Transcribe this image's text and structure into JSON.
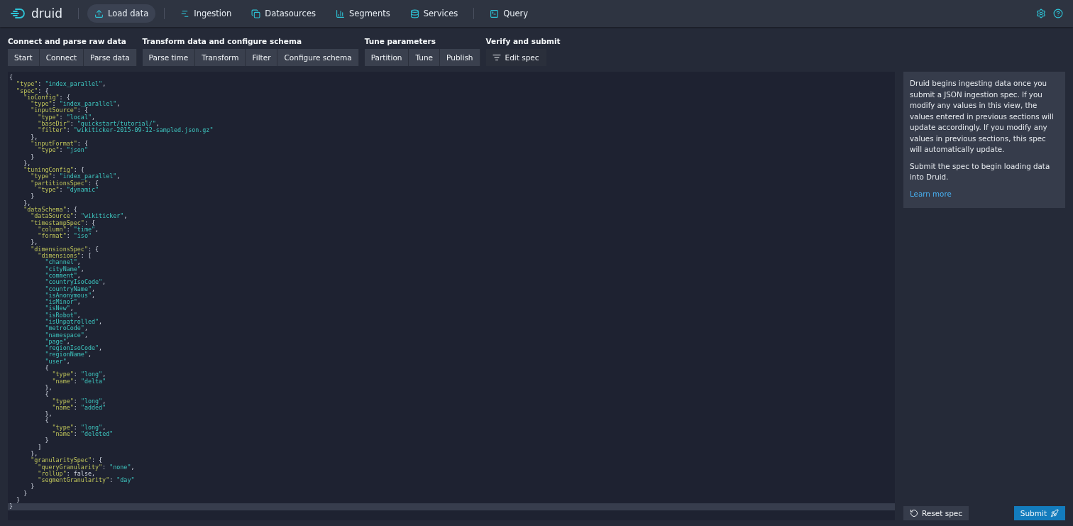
{
  "nav": {
    "logo": "druid",
    "items": [
      {
        "label": "Load data",
        "selected": true
      },
      {
        "label": "Ingestion",
        "selected": false
      },
      {
        "label": "Datasources",
        "selected": false
      },
      {
        "label": "Segments",
        "selected": false
      },
      {
        "label": "Services",
        "selected": false
      },
      {
        "label": "Query",
        "selected": false
      }
    ]
  },
  "steps": [
    {
      "title": "Connect and parse raw data",
      "buttons": [
        {
          "label": "Start",
          "selected": false
        },
        {
          "label": "Connect",
          "selected": false
        },
        {
          "label": "Parse data",
          "selected": false
        }
      ]
    },
    {
      "title": "Transform data and configure schema",
      "buttons": [
        {
          "label": "Parse time",
          "selected": false
        },
        {
          "label": "Transform",
          "selected": false
        },
        {
          "label": "Filter",
          "selected": false
        },
        {
          "label": "Configure schema",
          "selected": false
        }
      ]
    },
    {
      "title": "Tune parameters",
      "buttons": [
        {
          "label": "Partition",
          "selected": false
        },
        {
          "label": "Tune",
          "selected": false
        },
        {
          "label": "Publish",
          "selected": false
        }
      ]
    },
    {
      "title": "Verify and submit",
      "buttons": [
        {
          "label": "Edit spec",
          "selected": true
        }
      ]
    }
  ],
  "editor": {
    "lines": [
      {
        "text": "{",
        "current": false
      },
      {
        "text": "  \"type\": \"index_parallel\",",
        "current": false
      },
      {
        "text": "  \"spec\": {",
        "current": false
      },
      {
        "text": "    \"ioConfig\": {",
        "current": false
      },
      {
        "text": "      \"type\": \"index_parallel\",",
        "current": false
      },
      {
        "text": "      \"inputSource\": {",
        "current": false
      },
      {
        "text": "        \"type\": \"local\",",
        "current": false
      },
      {
        "text": "        \"baseDir\": \"quickstart/tutorial/\",",
        "current": false
      },
      {
        "text": "        \"filter\": \"wikiticker-2015-09-12-sampled.json.gz\"",
        "current": false
      },
      {
        "text": "      },",
        "current": false
      },
      {
        "text": "      \"inputFormat\": {",
        "current": false
      },
      {
        "text": "        \"type\": \"json\"",
        "current": false
      },
      {
        "text": "      }",
        "current": false
      },
      {
        "text": "    },",
        "current": false
      },
      {
        "text": "    \"tuningConfig\": {",
        "current": false
      },
      {
        "text": "      \"type\": \"index_parallel\",",
        "current": false
      },
      {
        "text": "      \"partitionsSpec\": {",
        "current": false
      },
      {
        "text": "        \"type\": \"dynamic\"",
        "current": false
      },
      {
        "text": "      }",
        "current": false
      },
      {
        "text": "    },",
        "current": false
      },
      {
        "text": "    \"dataSchema\": {",
        "current": false
      },
      {
        "text": "      \"dataSource\": \"wikiticker\",",
        "current": false
      },
      {
        "text": "      \"timestampSpec\": {",
        "current": false
      },
      {
        "text": "        \"column\": \"time\",",
        "current": false
      },
      {
        "text": "        \"format\": \"iso\"",
        "current": false
      },
      {
        "text": "      },",
        "current": false
      },
      {
        "text": "      \"dimensionsSpec\": {",
        "current": false
      },
      {
        "text": "        \"dimensions\": [",
        "current": false
      },
      {
        "text": "          \"channel\",",
        "current": false
      },
      {
        "text": "          \"cityName\",",
        "current": false
      },
      {
        "text": "          \"comment\",",
        "current": false
      },
      {
        "text": "          \"countryIsoCode\",",
        "current": false
      },
      {
        "text": "          \"countryName\",",
        "current": false
      },
      {
        "text": "          \"isAnonymous\",",
        "current": false
      },
      {
        "text": "          \"isMinor\",",
        "current": false
      },
      {
        "text": "          \"isNew\",",
        "current": false
      },
      {
        "text": "          \"isRobot\",",
        "current": false
      },
      {
        "text": "          \"isUnpatrolled\",",
        "current": false
      },
      {
        "text": "          \"metroCode\",",
        "current": false
      },
      {
        "text": "          \"namespace\",",
        "current": false
      },
      {
        "text": "          \"page\",",
        "current": false
      },
      {
        "text": "          \"regionIsoCode\",",
        "current": false
      },
      {
        "text": "          \"regionName\",",
        "current": false
      },
      {
        "text": "          \"user\",",
        "current": false
      },
      {
        "text": "          {",
        "current": false
      },
      {
        "text": "            \"type\": \"long\",",
        "current": false
      },
      {
        "text": "            \"name\": \"delta\"",
        "current": false
      },
      {
        "text": "          },",
        "current": false
      },
      {
        "text": "          {",
        "current": false
      },
      {
        "text": "            \"type\": \"long\",",
        "current": false
      },
      {
        "text": "            \"name\": \"added\"",
        "current": false
      },
      {
        "text": "          },",
        "current": false
      },
      {
        "text": "          {",
        "current": false
      },
      {
        "text": "            \"type\": \"long\",",
        "current": false
      },
      {
        "text": "            \"name\": \"deleted\"",
        "current": false
      },
      {
        "text": "          }",
        "current": false
      },
      {
        "text": "        ]",
        "current": false
      },
      {
        "text": "      },",
        "current": false
      },
      {
        "text": "      \"granularitySpec\": {",
        "current": false
      },
      {
        "text": "        \"queryGranularity\": \"none\",",
        "current": false
      },
      {
        "text": "        \"rollup\": false,",
        "current": false
      },
      {
        "text": "        \"segmentGranularity\": \"day\"",
        "current": false
      },
      {
        "text": "      }",
        "current": false
      },
      {
        "text": "    }",
        "current": false
      },
      {
        "text": "  }",
        "current": false
      },
      {
        "text": "}",
        "current": true
      }
    ]
  },
  "info": {
    "paragraphs": [
      "Druid begins ingesting data once you submit a JSON ingestion spec. If you modify any values in this view, the values entered in previous sections will update accordingly. If you modify any values in previous sections, this spec will automatically update.",
      "Submit the spec to begin loading data into Druid."
    ],
    "link": "Learn more"
  },
  "actions": {
    "reset": "Reset spec",
    "submit": "Submit"
  }
}
